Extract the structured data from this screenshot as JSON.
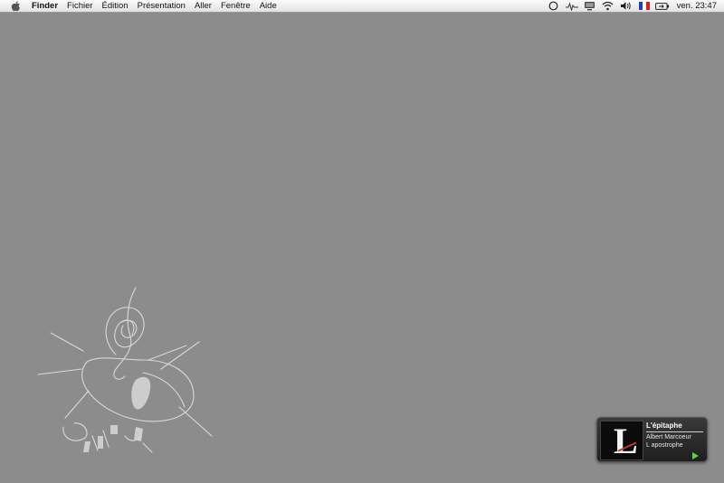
{
  "menubar": {
    "app_name": "Finder",
    "items": [
      "Fichier",
      "Édition",
      "Présentation",
      "Aller",
      "Fenêtre",
      "Aide"
    ],
    "clock": "ven. 23:47",
    "extras": [
      "circle-icon",
      "airport-signal-icon",
      "display-icon",
      "wifi-icon",
      "volume-icon",
      "french-flag-icon",
      "battery-icon"
    ]
  },
  "now_playing": {
    "title": "L'épitaphe",
    "artist": "Albert Marcoeur",
    "album": "L apostrophe",
    "art_letter": "L",
    "play_color": "#5bd33f"
  },
  "colors": {
    "desktop": "#8c8c8c",
    "widget_bg": "#2a2a2a"
  }
}
